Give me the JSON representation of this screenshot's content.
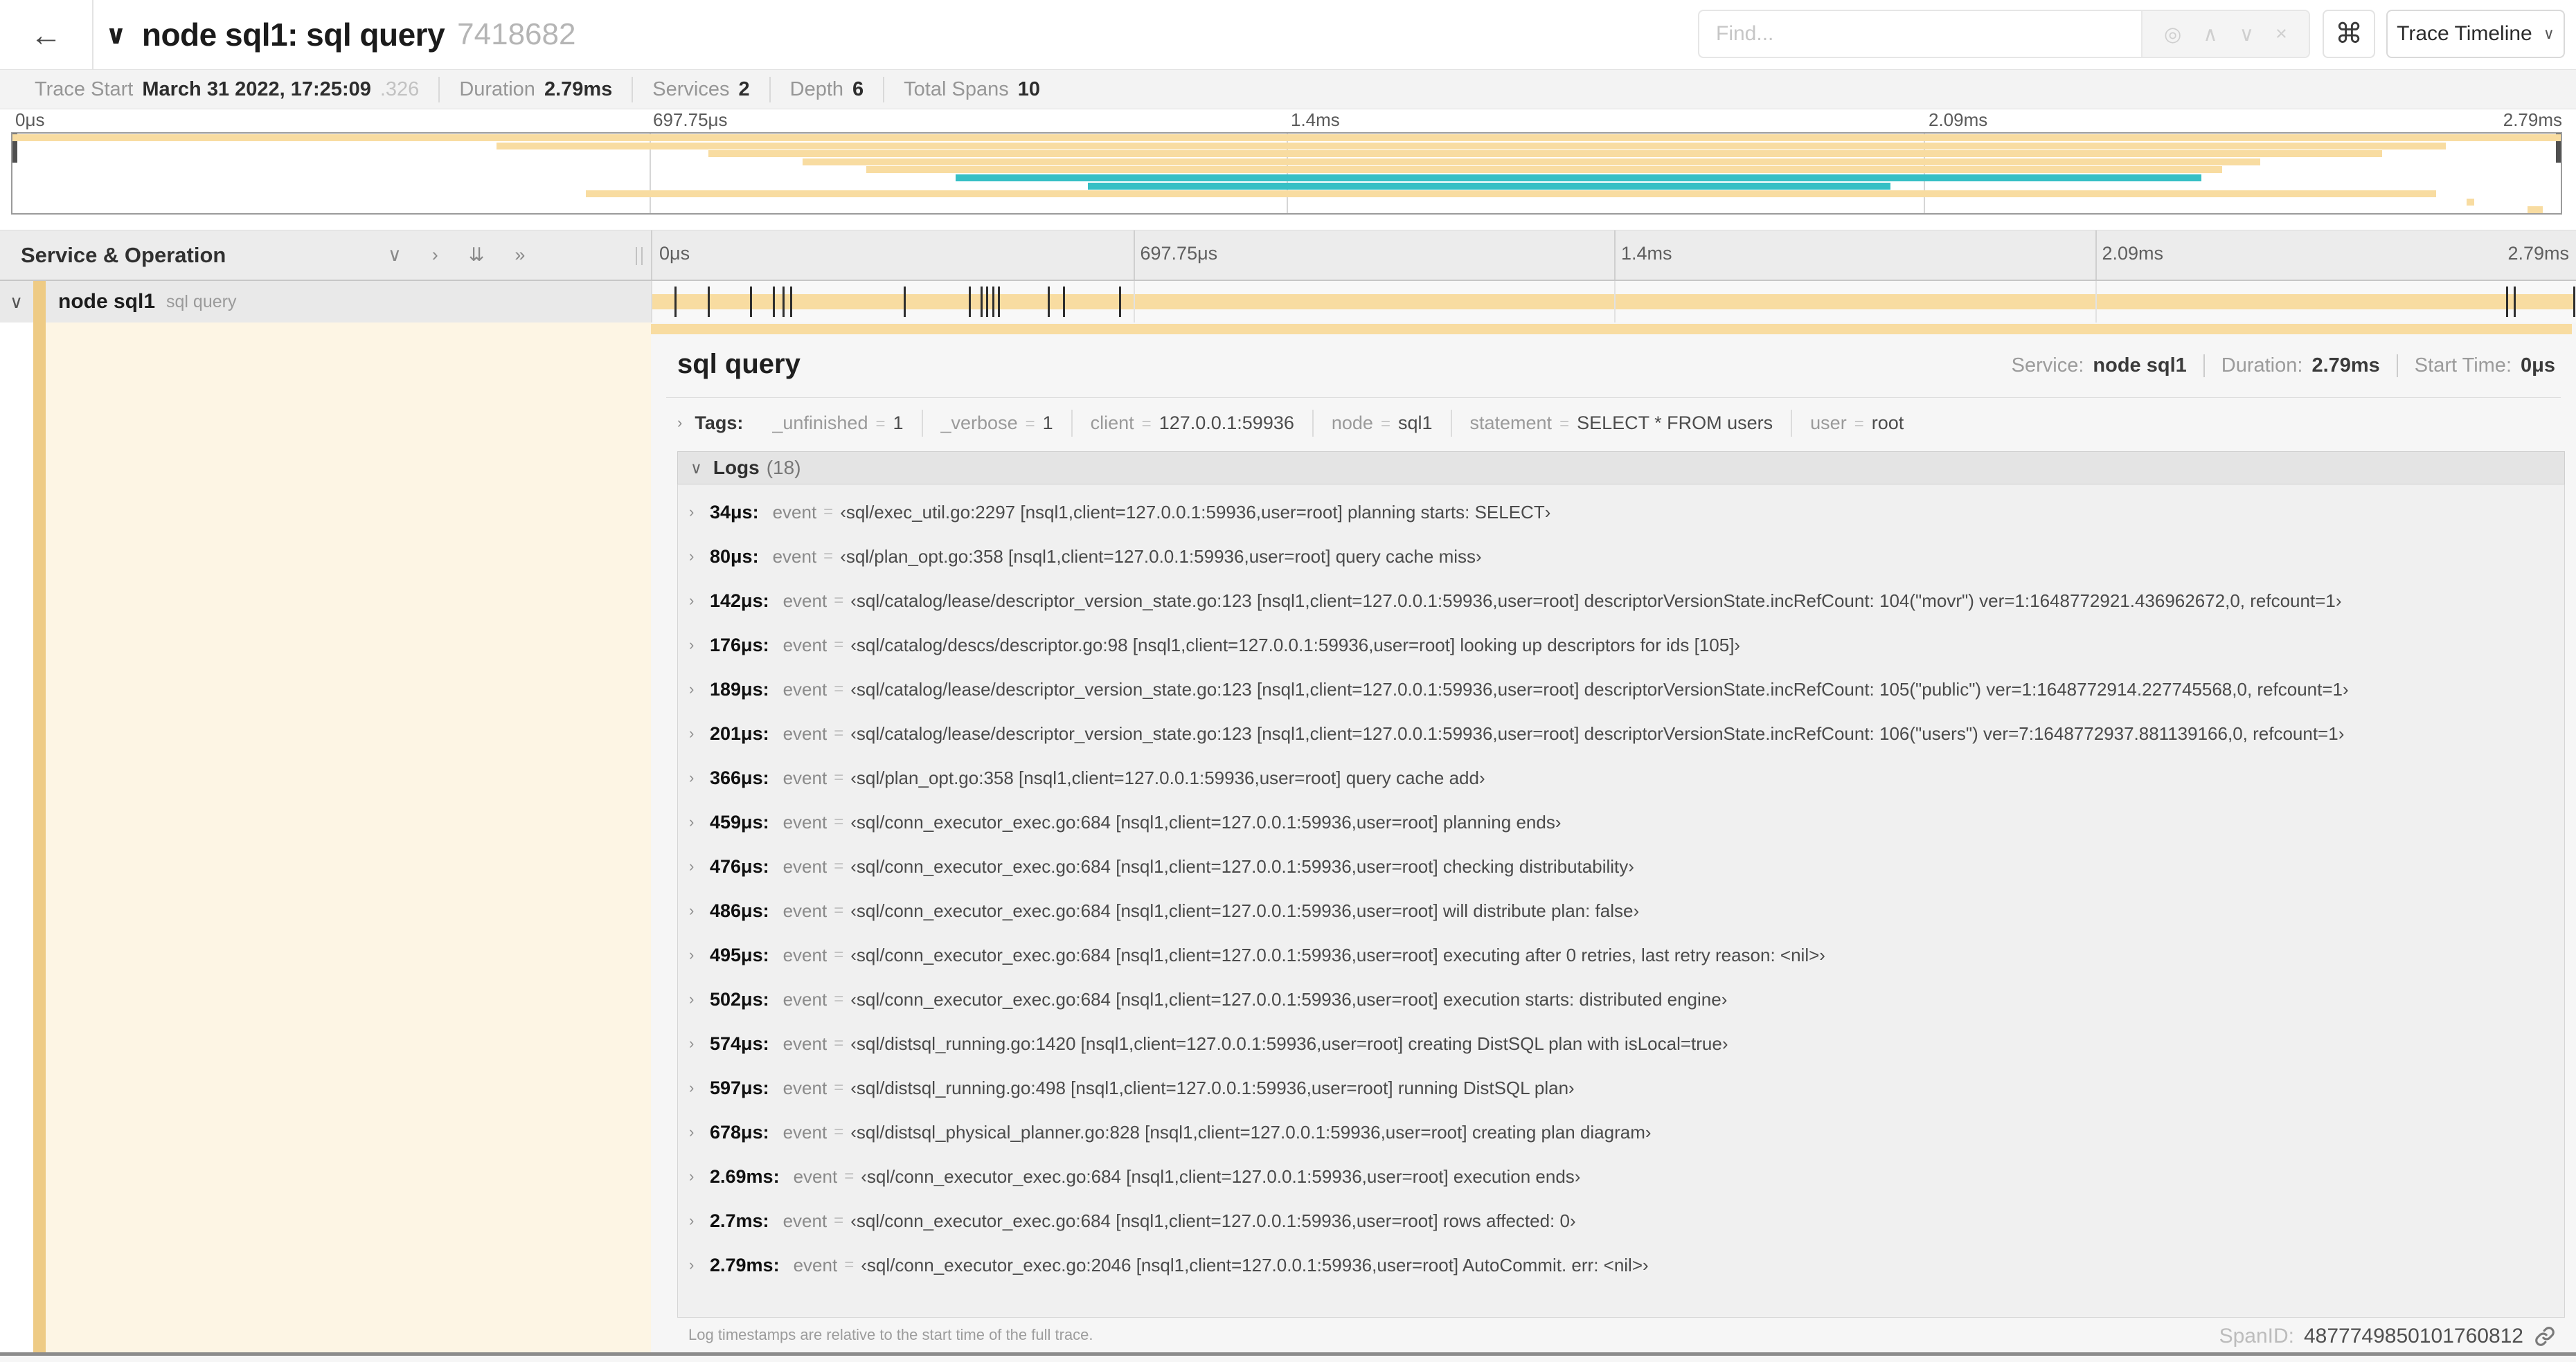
{
  "colors": {
    "tan": "#f8dca1",
    "teal": "#36bfc5",
    "stripe": "#eecb85",
    "tick": "#2e2e2e"
  },
  "icons": {
    "back": "←",
    "title_collapse": "∨",
    "locate": "◎",
    "prev_match": "∧",
    "next_match": "∨",
    "clear": "×",
    "keyboard_shortcuts": "⌘",
    "view_chevron": "∨",
    "collapse_one": "∨",
    "expand_one": "›",
    "collapse_all": "⇊",
    "expand_all": "»",
    "row_collapse": "∨",
    "section_expanded": "∨",
    "item_collapsed": "›"
  },
  "header": {
    "title": "node sql1: sql query",
    "trace_id": "7418682",
    "find_placeholder": "Find...",
    "view_button_label": "Trace Timeline"
  },
  "trace_meta": {
    "items": [
      {
        "label": "Trace Start",
        "value": "March 31 2022, 17:25:09",
        "suffix": ".326"
      },
      {
        "label": "Duration",
        "value": "2.79ms",
        "suffix": ""
      },
      {
        "label": "Services",
        "value": "2",
        "suffix": ""
      },
      {
        "label": "Depth",
        "value": "6",
        "suffix": ""
      },
      {
        "label": "Total Spans",
        "value": "10",
        "suffix": ""
      }
    ]
  },
  "timeline_ticks": [
    "0μs",
    "697.75μs",
    "1.4ms",
    "2.09ms",
    "2.79ms"
  ],
  "tick_positions_pct": [
    0,
    25,
    50,
    75,
    100
  ],
  "minimap": {
    "spans": [
      {
        "row": 1,
        "start": 0.0,
        "end": 1.0,
        "color": "tan"
      },
      {
        "row": 2,
        "start": 0.19,
        "end": 0.955,
        "color": "tan"
      },
      {
        "row": 3,
        "start": 0.273,
        "end": 0.93,
        "color": "tan"
      },
      {
        "row": 4,
        "start": 0.31,
        "end": 0.882,
        "color": "tan"
      },
      {
        "row": 5,
        "start": 0.335,
        "end": 0.867,
        "color": "tan"
      },
      {
        "row": 6,
        "start": 0.37,
        "end": 0.859,
        "color": "teal"
      },
      {
        "row": 7,
        "start": 0.422,
        "end": 0.737,
        "color": "teal"
      },
      {
        "row": 8,
        "start": 0.225,
        "end": 0.951,
        "color": "tan"
      },
      {
        "row": 9,
        "start": 0.963,
        "end": 0.966,
        "color": "tan"
      },
      {
        "row": 10,
        "start": 0.987,
        "end": 0.993,
        "color": "tan"
      }
    ]
  },
  "columns": {
    "label": "Service & Operation"
  },
  "span_row": {
    "service": "node sql1",
    "operation": "sql query",
    "tick_fractions": [
      0.012,
      0.029,
      0.051,
      0.063,
      0.068,
      0.072,
      0.131,
      0.165,
      0.171,
      0.174,
      0.177,
      0.18,
      0.206,
      0.214,
      0.243,
      0.964,
      0.968,
      0.999
    ]
  },
  "strings": {
    "eq": "="
  },
  "detail": {
    "title": "sql query",
    "meta": [
      {
        "label": "Service:",
        "value": "node sql1"
      },
      {
        "label": "Duration:",
        "value": "2.79ms"
      },
      {
        "label": "Start Time:",
        "value": "0μs"
      }
    ],
    "tags_label": "Tags:",
    "tags": [
      {
        "key": "_unfinished",
        "value": "1"
      },
      {
        "key": "_verbose",
        "value": "1"
      },
      {
        "key": "client",
        "value": "127.0.0.1:59936"
      },
      {
        "key": "node",
        "value": "sql1"
      },
      {
        "key": "statement",
        "value": "SELECT * FROM users"
      },
      {
        "key": "user",
        "value": "root"
      }
    ],
    "logs_label": "Logs",
    "logs_count": "(18)",
    "logs": [
      {
        "time": "34μs:",
        "field": "event",
        "value": "‹sql/exec_util.go:2297 [nsql1,client=127.0.0.1:59936,user=root] planning starts: SELECT›"
      },
      {
        "time": "80μs:",
        "field": "event",
        "value": "‹sql/plan_opt.go:358 [nsql1,client=127.0.0.1:59936,user=root] query cache miss›"
      },
      {
        "time": "142μs:",
        "field": "event",
        "value": "‹sql/catalog/lease/descriptor_version_state.go:123 [nsql1,client=127.0.0.1:59936,user=root] descriptorVersionState.incRefCount: 104(\"movr\") ver=1:1648772921.436962672,0, refcount=1›"
      },
      {
        "time": "176μs:",
        "field": "event",
        "value": "‹sql/catalog/descs/descriptor.go:98 [nsql1,client=127.0.0.1:59936,user=root] looking up descriptors for ids [105]›"
      },
      {
        "time": "189μs:",
        "field": "event",
        "value": "‹sql/catalog/lease/descriptor_version_state.go:123 [nsql1,client=127.0.0.1:59936,user=root] descriptorVersionState.incRefCount: 105(\"public\") ver=1:1648772914.227745568,0, refcount=1›"
      },
      {
        "time": "201μs:",
        "field": "event",
        "value": "‹sql/catalog/lease/descriptor_version_state.go:123 [nsql1,client=127.0.0.1:59936,user=root] descriptorVersionState.incRefCount: 106(\"users\") ver=7:1648772937.881139166,0, refcount=1›"
      },
      {
        "time": "366μs:",
        "field": "event",
        "value": "‹sql/plan_opt.go:358 [nsql1,client=127.0.0.1:59936,user=root] query cache add›"
      },
      {
        "time": "459μs:",
        "field": "event",
        "value": "‹sql/conn_executor_exec.go:684 [nsql1,client=127.0.0.1:59936,user=root] planning ends›"
      },
      {
        "time": "476μs:",
        "field": "event",
        "value": "‹sql/conn_executor_exec.go:684 [nsql1,client=127.0.0.1:59936,user=root] checking distributability›"
      },
      {
        "time": "486μs:",
        "field": "event",
        "value": "‹sql/conn_executor_exec.go:684 [nsql1,client=127.0.0.1:59936,user=root] will distribute plan: false›"
      },
      {
        "time": "495μs:",
        "field": "event",
        "value": "‹sql/conn_executor_exec.go:684 [nsql1,client=127.0.0.1:59936,user=root] executing after 0 retries, last retry reason: <nil>›"
      },
      {
        "time": "502μs:",
        "field": "event",
        "value": "‹sql/conn_executor_exec.go:684 [nsql1,client=127.0.0.1:59936,user=root] execution starts: distributed engine›"
      },
      {
        "time": "574μs:",
        "field": "event",
        "value": "‹sql/distsql_running.go:1420 [nsql1,client=127.0.0.1:59936,user=root] creating DistSQL plan with isLocal=true›"
      },
      {
        "time": "597μs:",
        "field": "event",
        "value": "‹sql/distsql_running.go:498 [nsql1,client=127.0.0.1:59936,user=root] running DistSQL plan›"
      },
      {
        "time": "678μs:",
        "field": "event",
        "value": "‹sql/distsql_physical_planner.go:828 [nsql1,client=127.0.0.1:59936,user=root] creating plan diagram›"
      },
      {
        "time": "2.69ms:",
        "field": "event",
        "value": "‹sql/conn_executor_exec.go:684 [nsql1,client=127.0.0.1:59936,user=root] execution ends›"
      },
      {
        "time": "2.7ms:",
        "field": "event",
        "value": "‹sql/conn_executor_exec.go:684 [nsql1,client=127.0.0.1:59936,user=root] rows affected: 0›"
      },
      {
        "time": "2.79ms:",
        "field": "event",
        "value": "‹sql/conn_executor_exec.go:2046 [nsql1,client=127.0.0.1:59936,user=root] AutoCommit. err: <nil>›"
      }
    ],
    "footer_note": "Log timestamps are relative to the start time of the full trace.",
    "span_id_label": "SpanID:",
    "span_id": "4877749850101760812"
  }
}
